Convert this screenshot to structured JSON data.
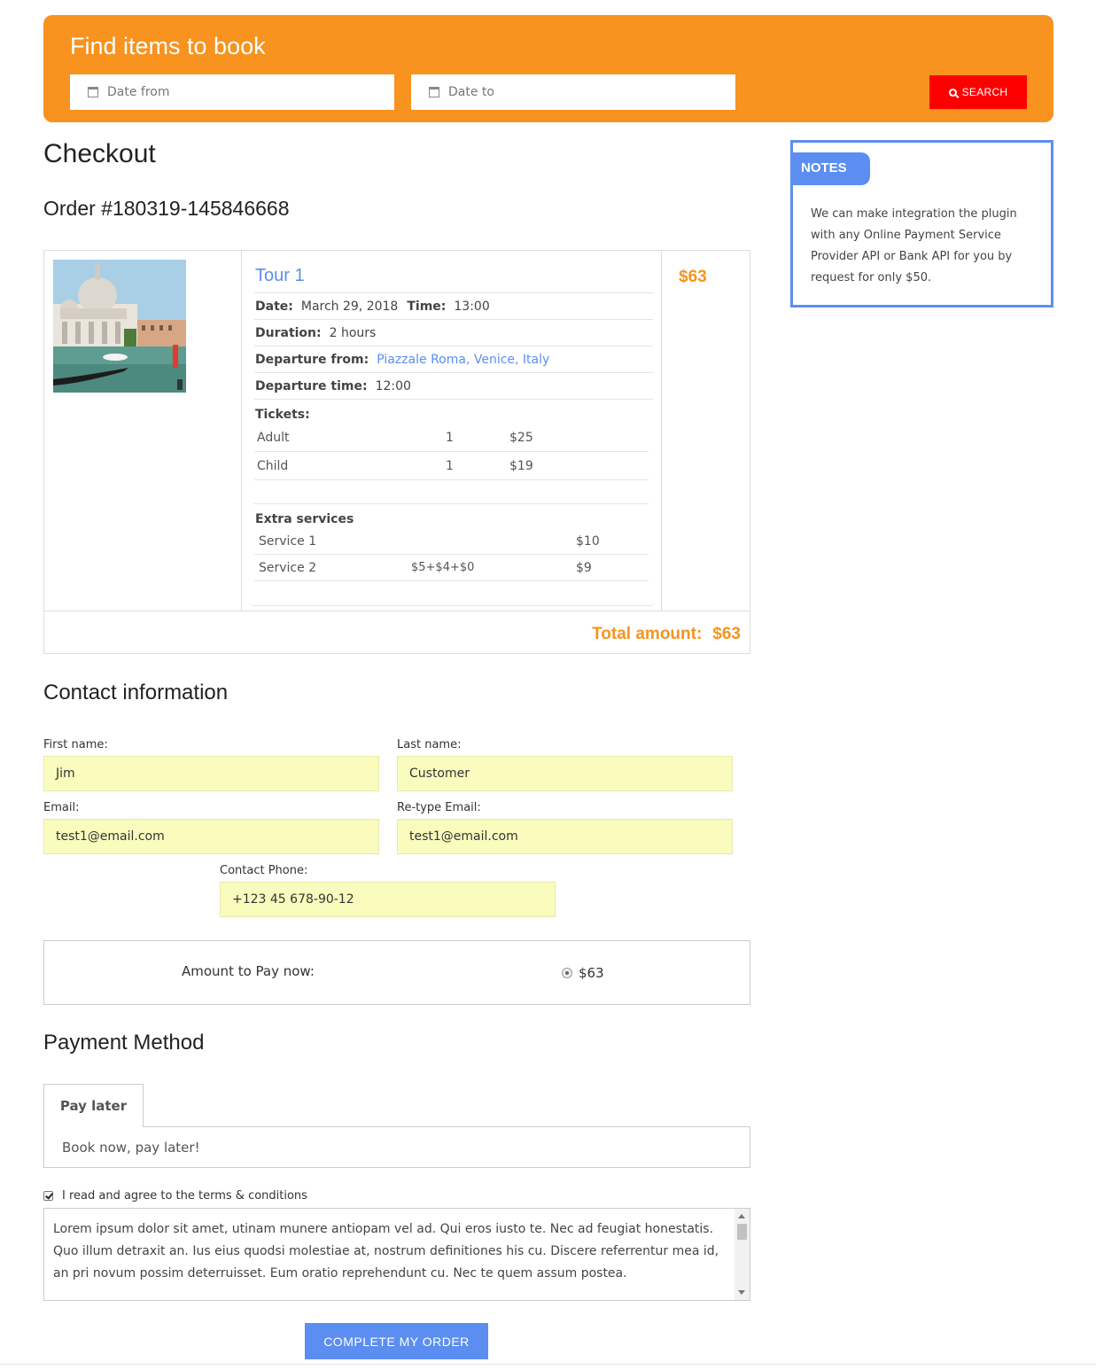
{
  "search": {
    "title": "Find items to book",
    "date_from_placeholder": "Date from",
    "date_to_placeholder": "Date to",
    "button_label": "SEARCH"
  },
  "page": {
    "heading": "Checkout",
    "order_label": "Order #180319-145846668"
  },
  "notes": {
    "tab_label": "NOTES",
    "text": "We can make integration the plugin with any Online Payment Service Provider API or Bank API for you by request for only $50."
  },
  "order": {
    "item_title": "Tour 1",
    "item_price": "$63",
    "date_label": "Date:",
    "date_value": "March 29, 2018",
    "time_label": "Time:",
    "time_value": "13:00",
    "duration_label": "Duration:",
    "duration_value": "2 hours",
    "departure_from_label": "Departure from:",
    "departure_from_value": "Piazzale Roma, Venice, Italy",
    "departure_time_label": "Departure time:",
    "departure_time_value": "12:00",
    "tickets_label": "Tickets:",
    "tickets": [
      {
        "name": "Adult",
        "qty": "1",
        "price": "$25"
      },
      {
        "name": "Child",
        "qty": "1",
        "price": "$19"
      }
    ],
    "extras_label": "Extra services",
    "extras": [
      {
        "name": "Service 1",
        "detail": "",
        "price": "$10"
      },
      {
        "name": "Service 2",
        "detail": "$5+$4+$0",
        "price": "$9"
      }
    ],
    "total_label": "Total amount:",
    "total_value": "$63"
  },
  "contact": {
    "heading": "Contact information",
    "first_name_label": "First name:",
    "first_name_value": "Jim",
    "last_name_label": "Last name:",
    "last_name_value": "Customer",
    "email_label": "Email:",
    "email_value": "test1@email.com",
    "retype_email_label": "Re-type Email:",
    "retype_email_value": "test1@email.com",
    "phone_label": "Contact Phone:",
    "phone_value": "+123 45 678-90-12"
  },
  "amount": {
    "label": "Amount to Pay now:",
    "option": "$63"
  },
  "payment": {
    "heading": "Payment Method",
    "tab_label": "Pay later",
    "tab_text": "Book now, pay later!"
  },
  "terms": {
    "agree_label": "I read and agree to the terms & conditions",
    "text": "Lorem ipsum dolor sit amet, utinam munere antiopam vel ad. Qui eros iusto te. Nec ad feugiat honestatis. Quo illum detraxit an. Ius eius quodsi molestiae at, nostrum definitiones his cu. Discere referrentur mea id, an pri novum possim deterruisset. Eum oratio reprehendunt cu. Nec te quem assum postea."
  },
  "submit_label": "COMPLETE MY ORDER",
  "colors": {
    "accent_orange": "#f7931e",
    "accent_blue": "#5b8ef0",
    "search_red": "#ff0000",
    "input_yellow": "#fafcbd"
  }
}
